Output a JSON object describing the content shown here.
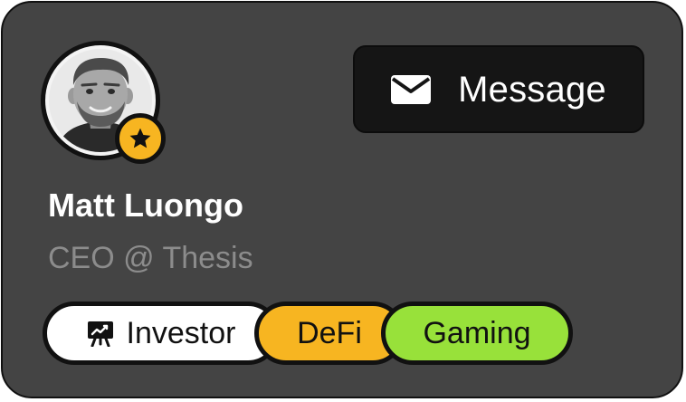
{
  "profile": {
    "name": "Matt Luongo",
    "subtitle": "CEO @ Thesis",
    "avatar_icon": "person-photo",
    "badge_icon": "star-icon"
  },
  "actions": {
    "message_label": "Message",
    "message_icon": "envelope-icon"
  },
  "tags": [
    {
      "label": "Investor",
      "icon": "presentation-chart-icon",
      "color": "#ffffff"
    },
    {
      "label": "DeFi",
      "color": "#f7b521"
    },
    {
      "label": "Gaming",
      "color": "#98e13a"
    }
  ],
  "colors": {
    "card_background": "#444444",
    "button_background": "#151515",
    "badge": "#f7b521",
    "subtitle_text": "#8c8c8c"
  }
}
